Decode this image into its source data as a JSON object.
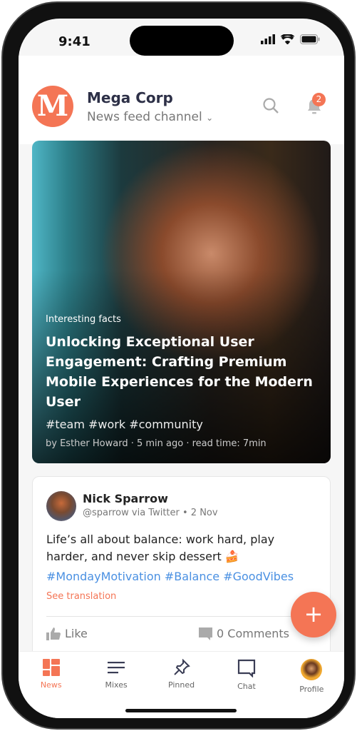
{
  "status": {
    "time": "9:41"
  },
  "header": {
    "logo_letter": "M",
    "brand": "Mega Corp",
    "channel": "News feed channel",
    "notification_count": "2"
  },
  "hero": {
    "category": "Interesting facts",
    "title": "Unlocking Exceptional User Engagement: Crafting Premium Mobile Experiences for the Modern User",
    "tags": "#team #work #community",
    "byline": "by Esther Howard · 5 min ago · read time: 7min"
  },
  "post": {
    "author": "Nick Sparrow",
    "meta": "@sparrow via Twitter • 2 Nov",
    "body": "Life’s all about balance: work hard, play harder, and never skip dessert 🍰",
    "tags": "#MondayMotivation #Balance #GoodVibes",
    "translate": "See translation",
    "like": "Like",
    "comments": "0 Comments"
  },
  "fab": "+",
  "tabs": [
    {
      "label": "News",
      "icon": "grid-icon",
      "active": true
    },
    {
      "label": "Mixes",
      "icon": "list-icon"
    },
    {
      "label": "Pinned",
      "icon": "pin-icon"
    },
    {
      "label": "Chat",
      "icon": "chat-icon"
    },
    {
      "label": "Profile",
      "icon": "avatar"
    }
  ],
  "colors": {
    "accent": "#f47555",
    "link": "#4a90e2",
    "brand_text": "#2d3047"
  }
}
